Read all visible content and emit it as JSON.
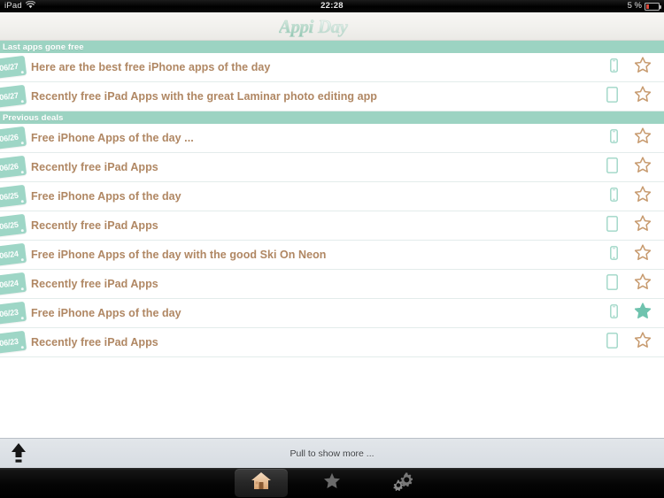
{
  "statusbar": {
    "carrier": "iPad",
    "wifi_icon": "wifi-icon",
    "time": "22:28",
    "battery_percent": "5 %",
    "battery_icon": "battery-low-icon"
  },
  "header": {
    "app_title": "AppiDay",
    "logo_part1": "Appi",
    "logo_part2": "Day"
  },
  "colors": {
    "accent_teal": "#9ed6c6",
    "section_header_bg": "#9cd3c2",
    "title_brown": "#b08763",
    "star_outline": "#c79a6e",
    "star_filled": "#6fc3ae",
    "row_bg": "#ffffff",
    "separator": "#e3eceb"
  },
  "sections": [
    {
      "title": "Last apps gone free",
      "rows": [
        {
          "date": "06/27",
          "title": "Here are the best free iPhone apps of the day",
          "device": "iphone",
          "device_icon": "iphone-icon",
          "starred": false,
          "star_icon": "star-outline-icon"
        },
        {
          "date": "06/27",
          "title": "Recently free iPad Apps with the great Laminar photo editing app",
          "device": "ipad",
          "device_icon": "ipad-icon",
          "starred": false,
          "star_icon": "star-outline-icon"
        }
      ]
    },
    {
      "title": "Previous deals",
      "rows": [
        {
          "date": "06/26",
          "title": "Free iPhone Apps of the day ...",
          "device": "iphone",
          "device_icon": "iphone-icon",
          "starred": false,
          "star_icon": "star-outline-icon"
        },
        {
          "date": "06/26",
          "title": "Recently free iPad Apps",
          "device": "ipad",
          "device_icon": "ipad-icon",
          "starred": false,
          "star_icon": "star-outline-icon"
        },
        {
          "date": "06/25",
          "title": "Free iPhone Apps of the day",
          "device": "iphone",
          "device_icon": "iphone-icon",
          "starred": false,
          "star_icon": "star-outline-icon"
        },
        {
          "date": "06/25",
          "title": "Recently free iPad Apps",
          "device": "ipad",
          "device_icon": "ipad-icon",
          "starred": false,
          "star_icon": "star-outline-icon"
        },
        {
          "date": "06/24",
          "title": "Free iPhone Apps of the day  with the good Ski On Neon",
          "device": "iphone",
          "device_icon": "iphone-icon",
          "starred": false,
          "star_icon": "star-outline-icon"
        },
        {
          "date": "06/24",
          "title": "Recently free iPad Apps",
          "device": "ipad",
          "device_icon": "ipad-icon",
          "starred": false,
          "star_icon": "star-outline-icon"
        },
        {
          "date": "06/23",
          "title": "Free iPhone Apps of the day",
          "device": "iphone",
          "device_icon": "iphone-icon",
          "starred": true,
          "star_icon": "star-filled-icon"
        },
        {
          "date": "06/23",
          "title": "Recently free iPad Apps",
          "device": "ipad",
          "device_icon": "ipad-icon",
          "starred": false,
          "star_icon": "star-outline-icon"
        }
      ]
    }
  ],
  "pull_to_refresh": {
    "label": "Pull to show more ...",
    "arrow_icon": "arrow-up-icon"
  },
  "tabbar": {
    "tabs": [
      {
        "name": "home",
        "icon": "house-icon",
        "selected": true
      },
      {
        "name": "favorites",
        "icon": "star-icon",
        "selected": false
      },
      {
        "name": "settings",
        "icon": "gears-icon",
        "selected": false
      }
    ]
  }
}
